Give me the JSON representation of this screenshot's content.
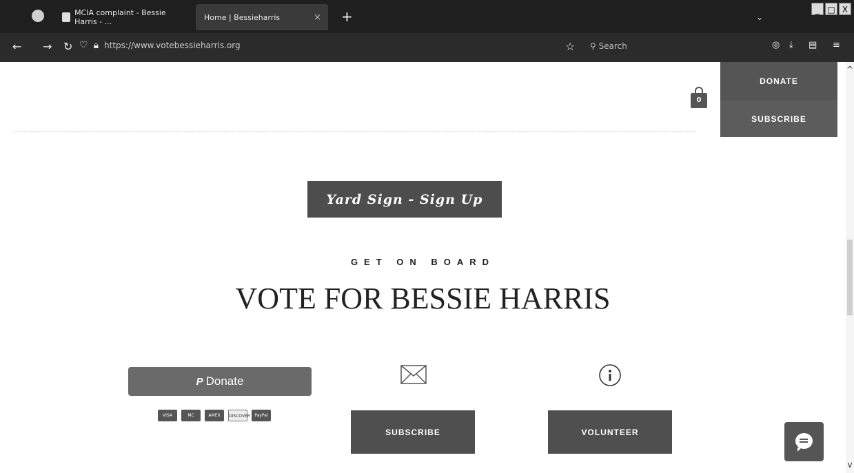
{
  "browser": {
    "tabs": [
      {
        "label": "MCIA complaint - Bessie Harris - ..."
      },
      {
        "label": "Home | Bessieharris"
      }
    ],
    "new_tab": "+",
    "url": "https://www.votebessieharris.org",
    "search_placeholder": "Search",
    "window_controls": [
      "_",
      "□",
      "X"
    ]
  },
  "site": {
    "cart_count": "0",
    "top_donate": "DONATE",
    "top_subscribe": "SUBSCRIBE",
    "yard_sign": "Yard Sign - Sign Up",
    "eyebrow": "GET ON BOARD",
    "headline": "VOTE FOR BESSIE HARRIS",
    "paypal_donate": "Donate",
    "payment_cards": [
      "VISA",
      "MC",
      "AMEX",
      "DISCOVER",
      "PayPal"
    ],
    "subscribe_button": "SUBSCRIBE",
    "volunteer_button": "VOLUNTEER"
  },
  "icons": {
    "mail": "mail-icon",
    "info": "info-icon",
    "chat": "chat-icon",
    "cart": "cart-icon"
  },
  "colors": {
    "button_dark": "#4f4f4f",
    "browser_chrome": "#1f1f1f"
  }
}
